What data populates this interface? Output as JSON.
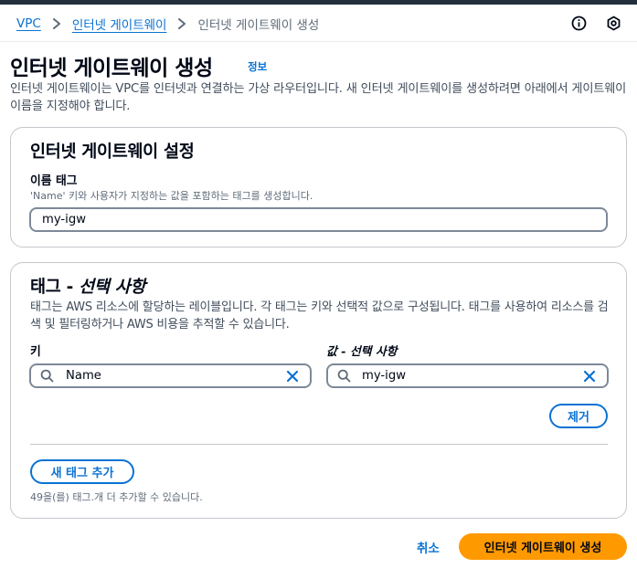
{
  "breadcrumb": {
    "items": [
      "VPC",
      "인터넷 게이트웨이"
    ],
    "current": "인터넷 게이트웨이 생성"
  },
  "icons": {
    "info": "info-circle-icon",
    "settings": "settings-icon",
    "chevron": "chevron-right-icon",
    "search": "search-icon",
    "clear": "close-icon"
  },
  "page": {
    "title": "인터넷 게이트웨이 생성",
    "info_link": "정보",
    "description": "인터넷 게이트웨이는 VPC를 인터넷과 연결하는 가상 라우터입니다. 새 인터넷 게이트웨이를 생성하려면 아래에서 게이트웨이 이름을 지정해야 합니다."
  },
  "settings_card": {
    "title": "인터넷 게이트웨이 설정",
    "name_tag_label": "이름 태그",
    "name_tag_hint": "'Name' 키와 사용자가 지정하는 값을 포함하는 태그를 생성합니다.",
    "name_tag_value": "my-igw"
  },
  "tags_card": {
    "title_main": "태그 - ",
    "title_optional": "선택 사항",
    "description": "태그는 AWS 리소스에 할당하는 레이블입니다. 각 태그는 키와 선택적 값으로 구성됩니다. 태그를 사용하여 리소스를 검색 및 필터링하거나 AWS 비용을 추적할 수 있습니다.",
    "key_label": "키",
    "value_label": "값 - 선택 사항",
    "tags": [
      {
        "key": "Name",
        "value": "my-igw"
      }
    ],
    "remove_button": "제거",
    "add_button": "새 태그 추가",
    "remaining_note": "49을(를) 태그.개 더 추가할 수 있습니다."
  },
  "footer": {
    "cancel": "취소",
    "submit": "인터넷 게이트웨이 생성"
  },
  "colors": {
    "link": "#0972d3",
    "primary_button": "#ff9900",
    "border": "#c6c6cd",
    "input_border": "#7d8998"
  }
}
